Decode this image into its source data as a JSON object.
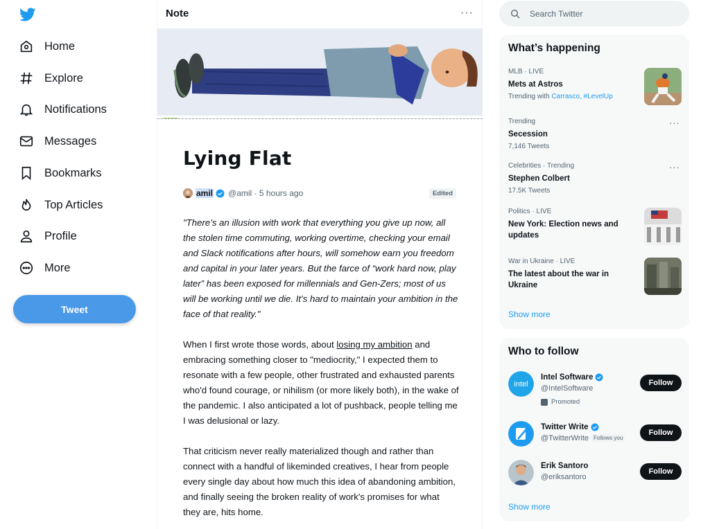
{
  "sidebar": {
    "items": [
      {
        "label": "Home",
        "icon": "home-icon"
      },
      {
        "label": "Explore",
        "icon": "hashtag-icon"
      },
      {
        "label": "Notifications",
        "icon": "bell-icon"
      },
      {
        "label": "Messages",
        "icon": "envelope-icon"
      },
      {
        "label": "Bookmarks",
        "icon": "bookmark-icon"
      },
      {
        "label": "Top Articles",
        "icon": "flame-icon"
      },
      {
        "label": "Profile",
        "icon": "person-icon"
      },
      {
        "label": "More",
        "icon": "more-circle-icon"
      }
    ],
    "tweet_label": "Tweet"
  },
  "note": {
    "header": "Note",
    "more": "···",
    "title": "Lying Flat",
    "author": "amil",
    "meta": "@amil · 5 hours ago",
    "edited": "Edited",
    "quote": "\"There’s an illusion with work that everything you give up now, all the stolen time commuting, working overtime, checking your email and Slack notifications after hours, will somehow earn you freedom and capital in your later years. But the farce of “work hard now, play later” has been exposed for millennials and Gen-Zers; most of us will be working until we die. It’s hard to maintain your ambition in the face of that reality.\"",
    "p1_before": "When I first wrote those words, about ",
    "p1_link": "losing my ambition",
    "p1_after": " and embracing something closer to \"mediocrity,\" I expected them to resonate with a few people, other frustrated and exhausted parents who'd found courage, or nihilism (or more likely both), in the wake of the pandemic. I also anticipated a lot of pushback, people telling me I was delusional or lazy.",
    "p2": "That criticism never really materialized though and rather than connect with a handful of likeminded creatives, I hear from people every single day about how much this idea of abandoning ambition, and finally seeing the broken reality of work's promises for what they are, hits home."
  },
  "search": {
    "placeholder": "Search Twitter"
  },
  "happening": {
    "title": "What’s happening",
    "trends": [
      {
        "cat": "MLB · LIVE",
        "name": "Mets at Astros",
        "sub_prefix": "Trending with ",
        "sub_links": "Carrasco, #LevelUp"
      },
      {
        "cat": "Trending",
        "name": "Secession",
        "sub": "7,146 Tweets"
      },
      {
        "cat": "Celebrities · Trending",
        "name": "Stephen Colbert",
        "sub": "17.5K Tweets"
      },
      {
        "cat": "Politics · LIVE",
        "name": "New York: Election news and updates"
      },
      {
        "cat": "War in Ukraine · LIVE",
        "name": "The latest about the war in Ukraine"
      }
    ],
    "show_more": "Show more"
  },
  "who_to_follow": {
    "title": "Who to follow",
    "accounts": [
      {
        "name": "Intel Software",
        "handle": "@IntelSoftware",
        "promoted": "Promoted",
        "avatar_text": "intel"
      },
      {
        "name": "Twitter Write",
        "handle": "@TwitterWrite",
        "follows_you": "Follows you"
      },
      {
        "name": "Erik Santoro",
        "handle": "@eriksantoro"
      }
    ],
    "follow_label": "Follow",
    "show_more": "Show more"
  },
  "colors": {
    "accent": "#1d9bf0",
    "tweet_button": "#4a99e9",
    "text": "#0f1419",
    "muted": "#536471"
  }
}
